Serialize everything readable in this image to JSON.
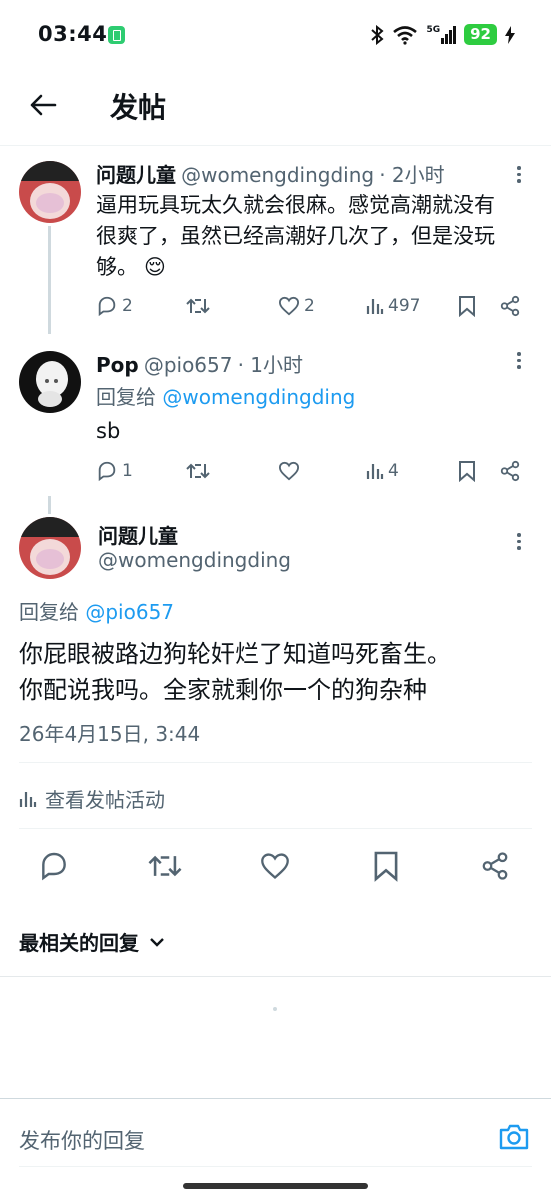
{
  "status_bar": {
    "time": "03:44",
    "network": "5G",
    "battery": "92"
  },
  "header": {
    "title": "发帖"
  },
  "tweets": [
    {
      "name": "问题儿童",
      "handle": "@womengdingding",
      "time": "· 2小时",
      "text_line1": "逼用玩具玩太久就会很麻。感觉高潮就没有",
      "text_line2": "很爽了，虽然已经高潮好几次了，但是没玩",
      "text_line3": "够。",
      "emoji": "😌",
      "replies": "2",
      "retweets": "",
      "likes": "2",
      "views": "497"
    },
    {
      "name": "Pop",
      "handle": "@pio657",
      "time": "· 1小时",
      "reply_prefix": "回复给",
      "reply_to": "@womengdingding",
      "text": "sb",
      "replies": "1",
      "retweets": "",
      "likes": "",
      "views": "4"
    }
  ],
  "main_tweet": {
    "name": "问题儿童",
    "handle": "@womengdingding",
    "reply_prefix": "回复给",
    "reply_to": "@pio657",
    "text_line1": "你屁眼被路边狗轮奸烂了知道吗死畜生。",
    "text_line2": "你配说我吗。全家就剩你一个的狗杂种",
    "timestamp": "26年4月15日, 3:44",
    "activity_label": "查看发帖活动"
  },
  "replies_sort": {
    "label": "最相关的回复"
  },
  "reply_composer": {
    "placeholder": "发布你的回复"
  },
  "colors": {
    "accent": "#1d9bf0",
    "battery": "#2ecc40",
    "text": "#0f1419",
    "muted": "#536471"
  },
  "icons": [
    "arrow-left-icon",
    "reply-icon",
    "retweet-icon",
    "like-icon",
    "views-icon",
    "bookmark-icon",
    "share-icon",
    "camera-icon",
    "chevron-down-icon",
    "more-icon"
  ]
}
